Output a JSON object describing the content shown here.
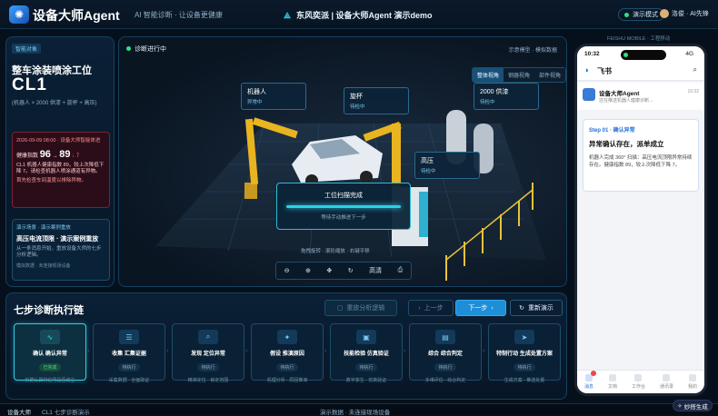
{
  "header": {
    "logo_icon": "robot-logo-icon",
    "brand": "设备大师Agent",
    "tagline": "AI 智能诊断 · 让设备更健康",
    "center_title": "东风奕派 | 设备大师Agent 演示demo",
    "demo_mode": "演示模式",
    "user": "洛俊 · AI先锋"
  },
  "left_panel": {
    "tag": "智能对象",
    "station_title": "整车涂装喷涂工位",
    "station_code": "CL1",
    "station_sub": "(机器人 × 2000 供漆 + 旋杯 + 高压)",
    "alert": {
      "time": "2026-09-09 08:00 · 设备大师智能体进",
      "label": "健康指数",
      "from": "96",
      "arrow": "→",
      "to": "89",
      "trend": "↓ 7",
      "text1": "CL1 机器人健康指数 89，较上次降低下降 7。请检查机器人喷涂通道有异物。",
      "text2": "首先检查车间温度以排除异物。"
    },
    "case": {
      "tag": "演示场景 · 演示案例重放",
      "title": "高压电流顶限 · 演示案例重放",
      "desc": "从一条消息开始，重放设备大师的七步分析逻辑。",
      "footer": "模拟数据 · 未连接现场设备"
    }
  },
  "scene": {
    "status": "诊断进行中",
    "right_note": "示意模型 · 模拟数据",
    "views": [
      "整体视角",
      "钢器视角",
      "部件视角"
    ],
    "callouts": [
      {
        "name": "机器人",
        "status": "异常中"
      },
      {
        "name": "旋杯",
        "status": "待检中"
      },
      {
        "name": "2000 供漆",
        "status": "待检中"
      },
      {
        "name": "高压",
        "status": "待检中"
      }
    ],
    "scan": {
      "title": "工位扫描完成",
      "sub": "等待手动推进下一步"
    },
    "legend": "拖拽旋转 · 滚轮缩放 · 右键平移",
    "tools": [
      "缩小",
      "放大",
      "平移",
      "复位",
      "高清",
      "截图"
    ]
  },
  "steps": {
    "title": "七步诊断执行链",
    "btn_reset": "重放分析逻辑",
    "btn_prev": "上一步",
    "btn_next": "下一步",
    "btn_replay": "重新演示",
    "items": [
      {
        "name": "确认 确认异常",
        "status": "已完成",
        "desc": "仅确认异常信号是否成立",
        "icon": "pulse-icon"
      },
      {
        "name": "收集 汇集证据",
        "status": "待执行",
        "desc": "采集数据 · 全面取证",
        "icon": "database-icon"
      },
      {
        "name": "发现 定位异常",
        "status": "待执行",
        "desc": "精准定位 · 锁定范围",
        "icon": "search-icon"
      },
      {
        "name": "假设 推演原因",
        "status": "待执行",
        "desc": "机理分析 · 原因推演",
        "icon": "lightbulb-icon"
      },
      {
        "name": "技能检验 仿真验证",
        "status": "待执行",
        "desc": "数字孪生 · 仿真验证",
        "icon": "chip-icon"
      },
      {
        "name": "综合 综合判定",
        "status": "待执行",
        "desc": "多维评估 · 综合判定",
        "icon": "document-icon"
      },
      {
        "name": "特制行动 生成处置方案",
        "status": "待执行",
        "desc": "生成方案 · 推送处置",
        "icon": "send-icon"
      }
    ]
  },
  "phone": {
    "label": "FEISHU MOBILE · 工程移动",
    "time": "10:32",
    "signal": "4G",
    "app": "飞书",
    "sender": "设备大师Agent",
    "msg_time": "10:32",
    "msg_preview": "还在推送机器人健康诊断...",
    "card": {
      "step": "Step 01 · 确认异常",
      "title": "异常确认存在，派单成立",
      "body": "机器人完成 360° 扫描：高压电流顶限异常持续存在。健康指数 89，较上次降低下降 7。"
    },
    "tabs": [
      "消息",
      "文档",
      "工作台",
      "通讯录",
      "我的"
    ]
  },
  "footer": {
    "left": "设备大师",
    "left2": "CL1 七步诊断演示",
    "center": "演示数据 · 未连接现场设备",
    "gen": "妙搭生成"
  }
}
